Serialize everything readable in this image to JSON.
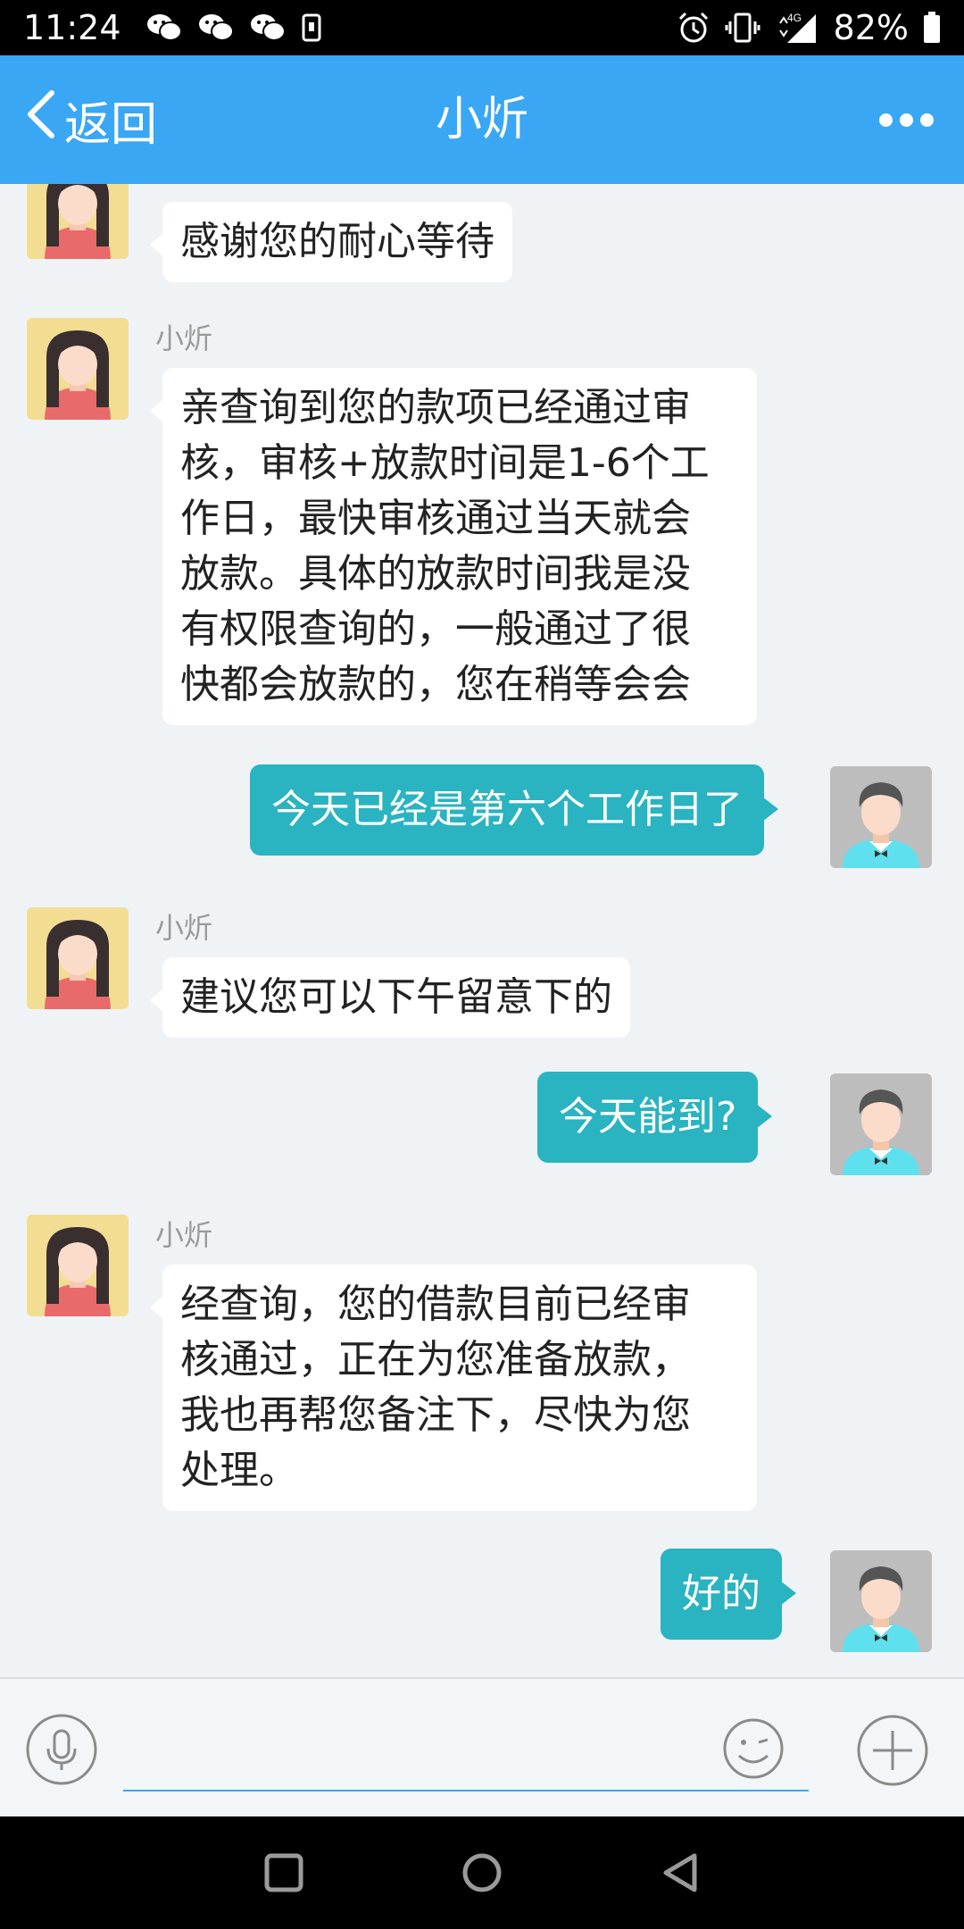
{
  "status_bar": {
    "time": "11:24",
    "network": "4G",
    "battery": "82%",
    "icons": [
      "wechat-icon",
      "wechat-icon",
      "wechat-icon",
      "sim-icon",
      "alarm-icon",
      "vibrate-icon",
      "signal-icon",
      "battery-icon"
    ]
  },
  "header": {
    "back_label": "返回",
    "title": "小炘",
    "more_icon": "more-dots-icon"
  },
  "messages": [
    {
      "from": "agent",
      "name": "",
      "text": "感谢您的耐心等待"
    },
    {
      "from": "agent",
      "name": "小炘",
      "lines": [
        "亲查询到您的款项已经通过审",
        "核，审核+放款时间是1-6个工",
        "作日，最快审核通过当天就会",
        "放款。具体的放款时间我是没",
        "有权限查询的，一般通过了很",
        "快都会放款的，您在稍等会会"
      ]
    },
    {
      "from": "user",
      "text": "今天已经是第六个工作日了"
    },
    {
      "from": "agent",
      "name": "小炘",
      "text": "建议您可以下午留意下的"
    },
    {
      "from": "user",
      "text": "今天能到?"
    },
    {
      "from": "agent",
      "name": "小炘",
      "lines": [
        "经查询，您的借款目前已经审",
        "核通过，正在为您准备放款，",
        "我也再帮您备注下，尽快为您",
        "处理。"
      ]
    },
    {
      "from": "user",
      "text": "好的"
    }
  ],
  "input_bar": {
    "voice_icon": "microphone-icon",
    "emoji_icon": "emoji-icon",
    "add_icon": "plus-icon",
    "placeholder": ""
  },
  "nav_bar": {
    "icons": [
      "recent-apps-icon",
      "home-icon",
      "back-triangle-icon"
    ]
  },
  "colors": {
    "header": "#3aa7f4",
    "user_bubble": "#2ab3c1",
    "agent_bubble": "#ffffff",
    "background": "#eff3f5"
  }
}
